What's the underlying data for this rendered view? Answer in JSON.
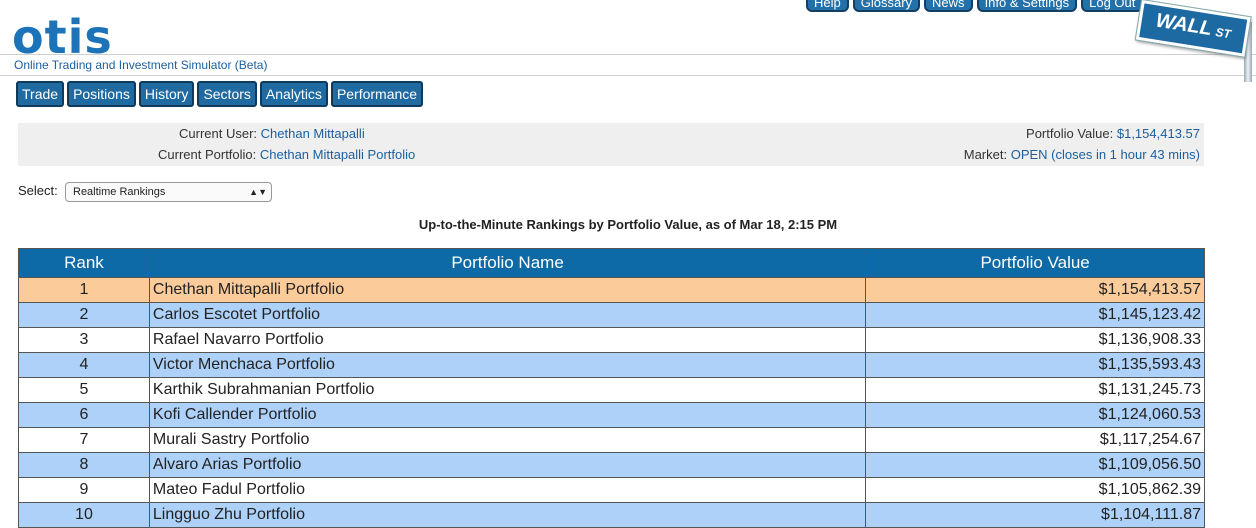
{
  "app": {
    "logo": "otis",
    "tagline": "Online Trading and Investment Simulator (Beta)",
    "badge_main": "WALL",
    "badge_sub": "ST"
  },
  "topnav": [
    "Help",
    "Glossary",
    "News",
    "Info & Settings",
    "Log Out"
  ],
  "mainnav": [
    "Trade",
    "Positions",
    "History",
    "Sectors",
    "Analytics",
    "Performance"
  ],
  "panel": {
    "user_label": "Current User:",
    "user_value": "Chethan Mittapalli",
    "portfolio_label": "Current Portfolio:",
    "portfolio_value": "Chethan Mittapalli Portfolio",
    "pv_label": "Portfolio Value:",
    "pv_value": "$1,154,413.57",
    "market_label": "Market:",
    "market_value": "OPEN (closes in 1 hour 43 mins)"
  },
  "select": {
    "label": "Select:",
    "value": "Realtime Rankings"
  },
  "caption": "Up-to-the-Minute Rankings by Portfolio Value, as of Mar 18, 2:15 PM",
  "table": {
    "headers": [
      "Rank",
      "Portfolio Name",
      "Portfolio Value"
    ],
    "rows": [
      {
        "rank": "1",
        "name": "Chethan Mittapalli Portfolio",
        "value": "$1,154,413.57"
      },
      {
        "rank": "2",
        "name": "Carlos Escotet Portfolio",
        "value": "$1,145,123.42"
      },
      {
        "rank": "3",
        "name": "Rafael Navarro Portfolio",
        "value": "$1,136,908.33"
      },
      {
        "rank": "4",
        "name": "Victor Menchaca Portfolio",
        "value": "$1,135,593.43"
      },
      {
        "rank": "5",
        "name": "Karthik Subrahmanian Portfolio",
        "value": "$1,131,245.73"
      },
      {
        "rank": "6",
        "name": "Kofi Callender Portfolio",
        "value": "$1,124,060.53"
      },
      {
        "rank": "7",
        "name": "Murali Sastry Portfolio",
        "value": "$1,117,254.67"
      },
      {
        "rank": "8",
        "name": "Alvaro Arias Portfolio",
        "value": "$1,109,056.50"
      },
      {
        "rank": "9",
        "name": "Mateo Fadul Portfolio",
        "value": "$1,105,862.39"
      },
      {
        "rank": "10",
        "name": "Lingguo Zhu Portfolio",
        "value": "$1,104,111.87"
      }
    ]
  }
}
